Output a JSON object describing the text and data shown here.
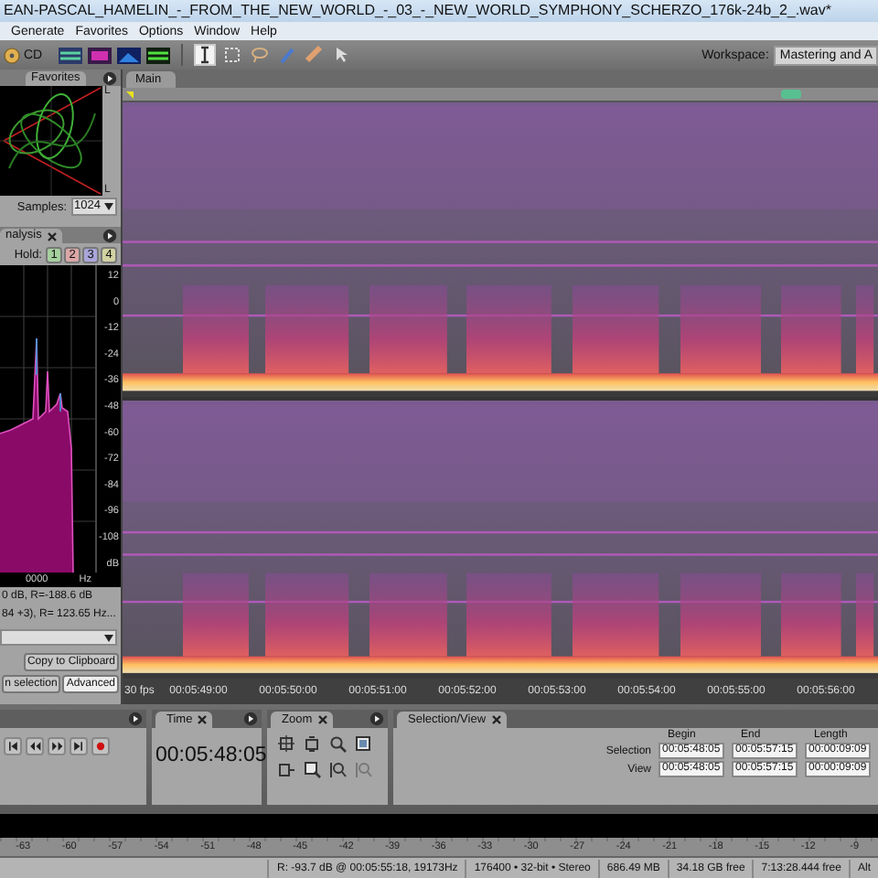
{
  "window": {
    "title": "EAN-PASCAL_HAMELIN_-_FROM_THE_NEW_WORLD_-_03_-_NEW_WORLD_SYMPHONY_SCHERZO_176k-24b_2_.wav*"
  },
  "menu": [
    "Generate",
    "Favorites",
    "Options",
    "Window",
    "Help"
  ],
  "toolbar": {
    "cd_label": "CD",
    "views": [
      {
        "kind": "waveform"
      },
      {
        "kind": "spectral"
      },
      {
        "kind": "pan"
      },
      {
        "kind": "phase"
      }
    ],
    "tools": [
      {
        "kind": "time",
        "selected": true
      },
      {
        "kind": "marquee",
        "selected": false
      },
      {
        "kind": "lasso",
        "selected": false
      },
      {
        "kind": "brush",
        "selected": false
      },
      {
        "kind": "healing",
        "selected": false
      },
      {
        "kind": "move",
        "selected": false
      }
    ],
    "workspace_label": "Workspace:",
    "workspace_value": "Mastering and A"
  },
  "phase_panel": {
    "tab": "Favorites",
    "axis_labels": [
      "L",
      "L"
    ],
    "samples_label": "Samples:",
    "samples_value": "1024"
  },
  "analysis_panel": {
    "tab": "nalysis",
    "hold_label": "Hold:",
    "hold": [
      {
        "label": "1",
        "color": "#a6cf9e"
      },
      {
        "label": "2",
        "color": "#dba6a6"
      },
      {
        "label": "3",
        "color": "#aaa6da"
      },
      {
        "label": "4",
        "color": "#d2d2a2"
      }
    ],
    "y_labels": [
      "12",
      "0",
      "-12",
      "-24",
      "-36",
      "-48",
      "-60",
      "-72",
      "-84",
      "-96",
      "-108",
      "dB"
    ],
    "x_labels": [
      "0000",
      "Hz"
    ],
    "readouts": [
      "0 dB, R=-188.6 dB",
      "84 +3), R= 123.65 Hz..."
    ],
    "clipboard_button": "Copy to Clipboard",
    "buttons": [
      "n selection",
      "Advanced"
    ]
  },
  "main": {
    "tab": "Main",
    "fps": "30 fps",
    "times": [
      "00:05:49:00",
      "00:05:50:00",
      "00:05:51:00",
      "00:05:52:00",
      "00:05:53:00",
      "00:05:54:00",
      "00:05:55:00",
      "00:05:56:00"
    ]
  },
  "transport": [
    {
      "kind": "start"
    },
    {
      "kind": "rewind"
    },
    {
      "kind": "forward"
    },
    {
      "kind": "end"
    },
    {
      "kind": "record"
    }
  ],
  "time_panel": {
    "tab": "Time",
    "value": "00:05:48:05"
  },
  "zoom_panel": {
    "tab": "Zoom",
    "buttons": [
      {
        "kind": "in-amplitude"
      },
      {
        "kind": "out-amplitude"
      },
      {
        "kind": "in-point"
      },
      {
        "kind": "full"
      },
      {
        "kind": "in-left"
      },
      {
        "kind": "in-right"
      },
      {
        "kind": "selection"
      },
      {
        "kind": "out-full"
      }
    ]
  },
  "selection_panel": {
    "tab": "Selection/View",
    "columns": [
      "Begin",
      "End",
      "Length"
    ],
    "rows": [
      {
        "label": "Selection",
        "values": [
          "00:05:48:05",
          "00:05:57:15",
          "00:00:09:09"
        ]
      },
      {
        "label": "View",
        "values": [
          "00:05:48:05",
          "00:05:57:15",
          "00:00:09:09"
        ]
      }
    ]
  },
  "meter": {
    "scale": [
      "-63",
      "-60",
      "-57",
      "-54",
      "-51",
      "-48",
      "-45",
      "-42",
      "-39",
      "-36",
      "-33",
      "-30",
      "-27",
      "-24",
      "-21",
      "-18",
      "-15",
      "-12",
      "-9"
    ]
  },
  "status_bar": [
    "R: -93.7 dB @ 00:05:55:18, 19173Hz",
    "176400 • 32-bit • Stereo",
    "686.49 MB",
    "34.18 GB free",
    "7:13:28.444 free",
    "Alt"
  ]
}
